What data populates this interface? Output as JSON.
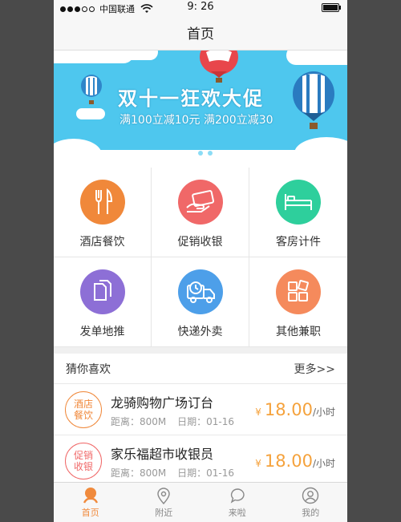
{
  "status": {
    "carrier": "中国联通",
    "time": "9: 26"
  },
  "nav": {
    "title": "首页"
  },
  "banner": {
    "title": "双十一狂欢大促",
    "subtitle": "满100立减10元 满200立减30",
    "page_count": 3,
    "active_page": 1
  },
  "categories": [
    {
      "label": "酒店餐饮",
      "icon": "fork-knife-icon",
      "color": "#f0883a"
    },
    {
      "label": "促销收银",
      "icon": "card-icon",
      "color": "#f06868"
    },
    {
      "label": "客房计件",
      "icon": "bed-icon",
      "color": "#2ecf9c"
    },
    {
      "label": "发单地推",
      "icon": "document-icon",
      "color": "#8d6fd6"
    },
    {
      "label": "快递外卖",
      "icon": "delivery-truck-icon",
      "color": "#4d9fe9"
    },
    {
      "label": "其他兼职",
      "icon": "grid-icon",
      "color": "#f58a5c"
    }
  ],
  "recommend": {
    "title": "猜你喜欢",
    "more": "更多>>",
    "items": [
      {
        "tag_line1": "酒店",
        "tag_line2": "餐饮",
        "tag_color": "#f0883a",
        "title": "龙骑购物广场订台",
        "distance": "距离：800M",
        "date": "日期：01-16",
        "yen": "¥",
        "price": "18.00",
        "unit": "/小时"
      },
      {
        "tag_line1": "促销",
        "tag_line2": "收银",
        "tag_color": "#f06868",
        "title": "家乐福超市收银员",
        "distance": "距离：800M",
        "date": "日期：01-16",
        "yen": "¥",
        "price": "18.00",
        "unit": "/小时"
      }
    ]
  },
  "tabs": [
    {
      "label": "首页",
      "active": true
    },
    {
      "label": "附近",
      "active": false
    },
    {
      "label": "来啦",
      "active": false
    },
    {
      "label": "我的",
      "active": false
    }
  ]
}
